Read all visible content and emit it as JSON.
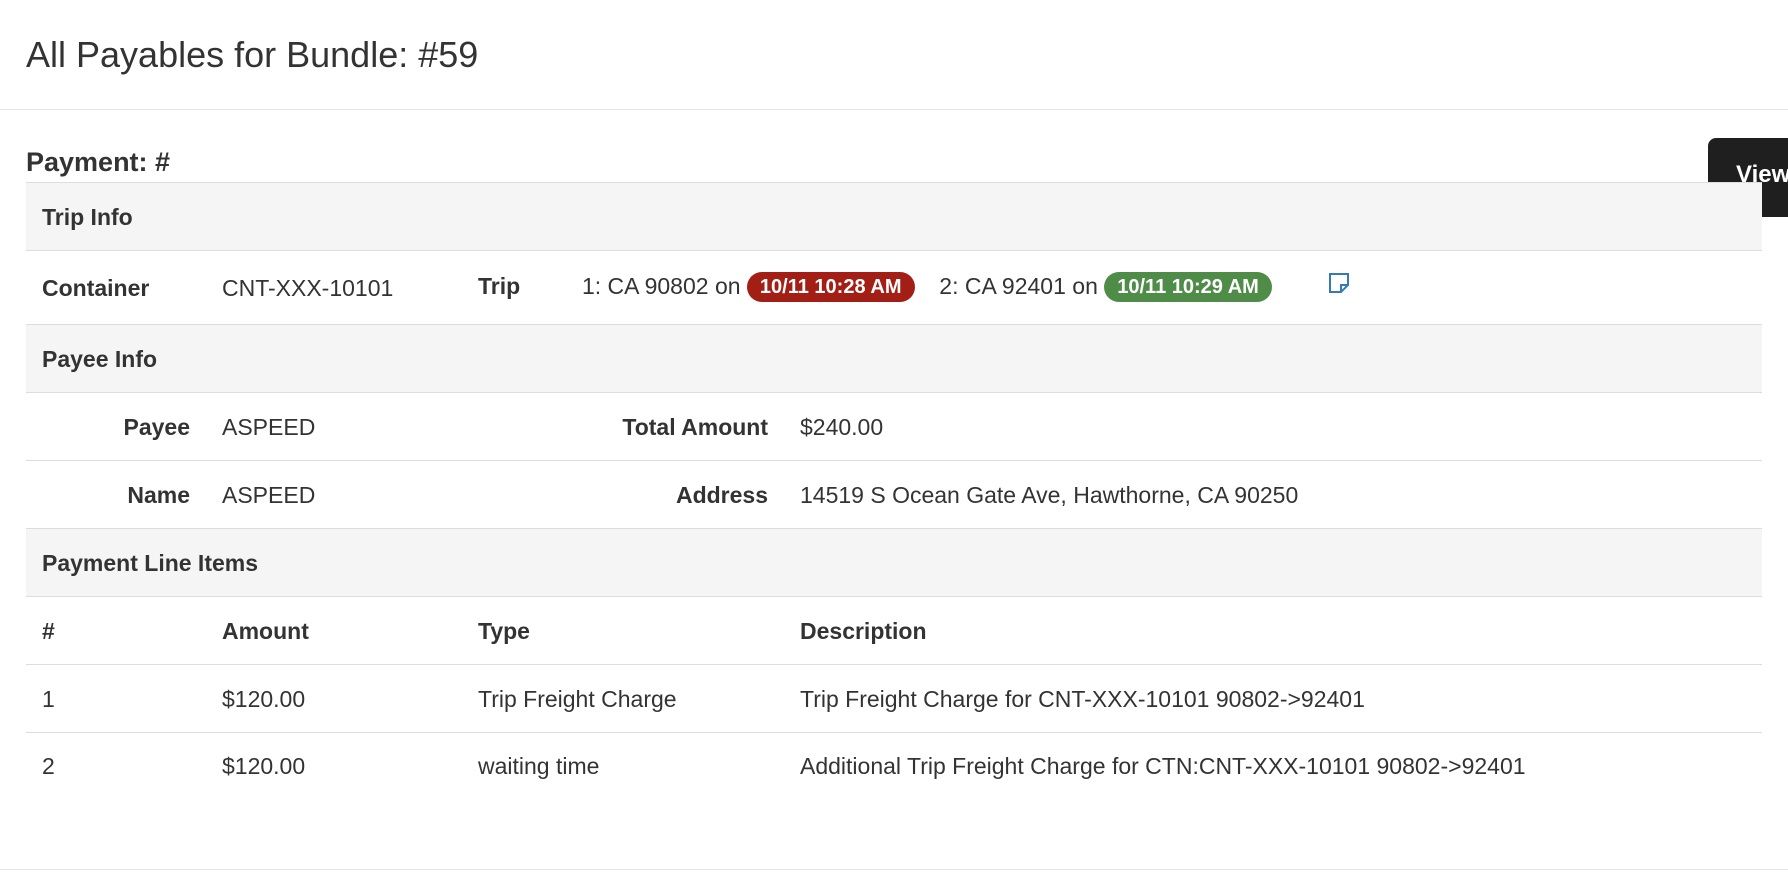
{
  "modal": {
    "title": "All Payables for Bundle: #59"
  },
  "payment": {
    "heading": "Payment: #",
    "view_tab_label": "View"
  },
  "trip_info": {
    "section_label": "Trip Info",
    "container_label": "Container",
    "container_value": "CNT-XXX-10101",
    "trip_label": "Trip",
    "stop1_text": "1: CA 90802 on",
    "stop1_time": "10/11 10:28 AM",
    "stop2_text": "2: CA 92401 on",
    "stop2_time": "10/11 10:29 AM",
    "note_icon": "note-icon",
    "stop1_color": "#a31f16",
    "stop2_color": "#4e8c48"
  },
  "payee_info": {
    "section_label": "Payee Info",
    "payee_label": "Payee",
    "payee_value": "ASPEED",
    "total_label": "Total Amount",
    "total_value": "$240.00",
    "name_label": "Name",
    "name_value": "ASPEED",
    "address_label": "Address",
    "address_value": "14519 S Ocean Gate Ave, Hawthorne, CA 90250"
  },
  "line_items": {
    "section_label": "Payment Line Items",
    "headers": [
      "#",
      "Amount",
      "Type",
      "Description"
    ],
    "rows": [
      {
        "num": "1",
        "amount": "$120.00",
        "type": "Trip Freight Charge",
        "description": "Trip Freight Charge for CNT-XXX-10101 90802->92401"
      },
      {
        "num": "2",
        "amount": "$120.00",
        "type": "waiting time",
        "description": "Additional Trip Freight Charge for CTN:CNT-XXX-10101 90802->92401"
      }
    ]
  }
}
